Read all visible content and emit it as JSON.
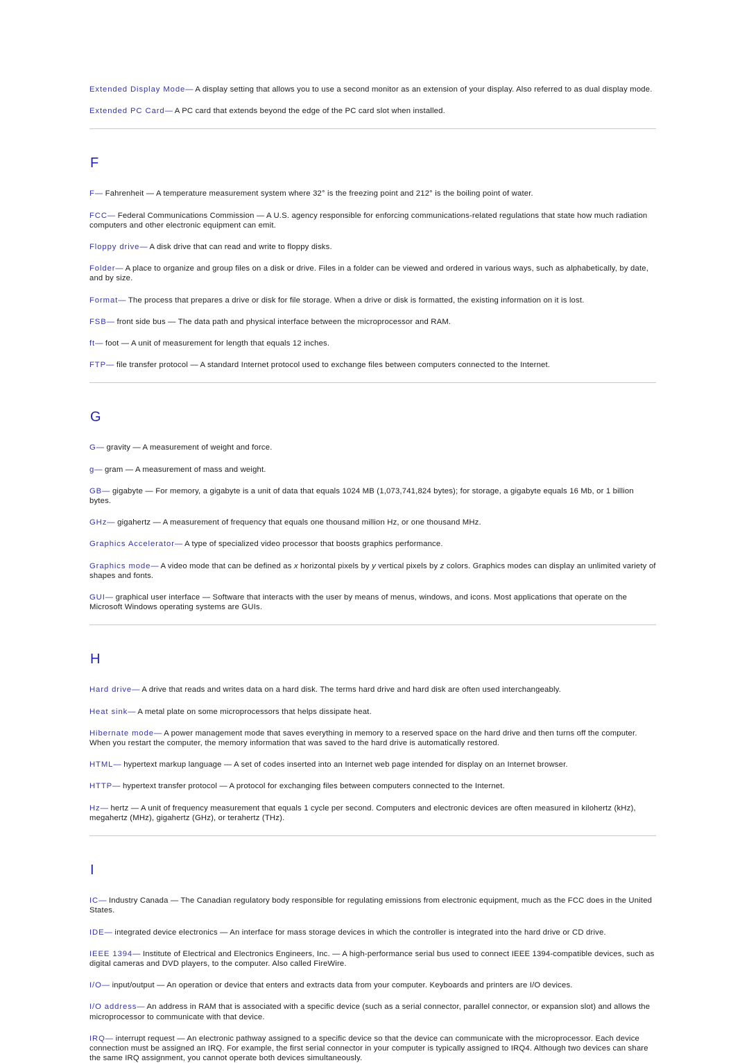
{
  "document": {
    "type": "glossary",
    "colors": {
      "term": "#3333aa",
      "heading": "#2222aa",
      "body": "#1a1a1a",
      "rule": "#c9c9c9",
      "background": "#ffffff"
    }
  },
  "top_entries": [
    {
      "term": "Extended Display Mode",
      "dash": "—",
      "definition": "A display setting that allows you to use a second monitor as an extension of your display. Also referred to as dual display mode."
    },
    {
      "term": "Extended PC Card",
      "dash": "—",
      "definition": "A PC card that extends beyond the edge of the PC card slot when installed."
    }
  ],
  "sections": [
    {
      "letter": "F",
      "entries": [
        {
          "term": "F",
          "dash": "—",
          "definition": "Fahrenheit — A temperature measurement system where 32° is the freezing point and 212° is the boiling point of water."
        },
        {
          "term": "FCC",
          "dash": "—",
          "definition": "Federal Communications Commission — A U.S. agency responsible for enforcing communications-related regulations that state how much radiation computers and other electronic equipment can emit."
        },
        {
          "term": "Floppy drive",
          "dash": "—",
          "definition": "A disk drive that can read and write to floppy disks."
        },
        {
          "term": "Folder",
          "dash": "—",
          "definition": "A place to organize and group files on a disk or drive. Files in a folder can be viewed and ordered in various ways, such as alphabetically, by date, and by size."
        },
        {
          "term": "Format",
          "dash": "—",
          "definition": "The process that prepares a drive or disk for file storage. When a drive or disk is formatted, the existing information on it is lost."
        },
        {
          "term": "FSB",
          "dash": "—",
          "definition": "front side bus — The data path and physical interface between the microprocessor and RAM."
        },
        {
          "term": "ft",
          "dash": "—",
          "definition": "foot — A unit of measurement for length that equals 12 inches."
        },
        {
          "term": "FTP",
          "dash": "—",
          "definition": "file transfer protocol — A standard Internet protocol used to exchange files between computers connected to the Internet."
        }
      ]
    },
    {
      "letter": "G",
      "entries": [
        {
          "term": "G",
          "dash": "—",
          "definition": "gravity — A measurement of weight and force."
        },
        {
          "term": "g",
          "dash": "—",
          "definition": "gram — A measurement of mass and weight."
        },
        {
          "term": "GB",
          "dash": "—",
          "definition": "gigabyte — For memory, a gigabyte is a unit of data that equals 1024 MB (1,073,741,824 bytes); for storage, a gigabyte equals 16 Mb, or 1 billion bytes."
        },
        {
          "term": "GHz",
          "dash": "—",
          "definition": "gigahertz — A measurement of frequency that equals one thousand million Hz, or one thousand MHz."
        },
        {
          "term": "Graphics Accelerator",
          "dash": "—",
          "definition": "A type of specialized video processor that boosts graphics performance."
        },
        {
          "term": "Graphics mode",
          "dash": "—",
          "definition_parts": [
            {
              "text": "A video mode that can be defined as ",
              "italic": false
            },
            {
              "text": "x",
              "italic": true
            },
            {
              "text": " horizontal pixels by ",
              "italic": false
            },
            {
              "text": "y",
              "italic": true
            },
            {
              "text": " vertical pixels by ",
              "italic": false
            },
            {
              "text": "z",
              "italic": true
            },
            {
              "text": " colors. Graphics modes can display an unlimited variety of shapes and fonts.",
              "italic": false
            }
          ]
        },
        {
          "term": "GUI",
          "dash": "—",
          "definition": "graphical user interface — Software that interacts with the user by means of menus, windows, and icons. Most applications that operate on the Microsoft Windows operating systems are GUIs."
        }
      ]
    },
    {
      "letter": "H",
      "entries": [
        {
          "term": "Hard drive",
          "dash": "—",
          "definition": "A drive that reads and writes data on a hard disk. The terms hard drive and hard disk are often used interchangeably."
        },
        {
          "term": "Heat sink",
          "dash": "—",
          "definition": "A metal plate on some microprocessors that helps dissipate heat."
        },
        {
          "term": "Hibernate mode",
          "dash": "—",
          "definition": "A power management mode that saves everything in memory to a reserved space on the hard drive and then turns off the computer. When you restart the computer, the memory information that was saved to the hard drive is automatically restored."
        },
        {
          "term": "HTML",
          "dash": "—",
          "definition": "hypertext markup language — A set of codes inserted into an Internet web page intended for display on an Internet browser."
        },
        {
          "term": "HTTP",
          "dash": "—",
          "definition": "hypertext transfer protocol — A protocol for exchanging files between computers connected to the Internet."
        },
        {
          "term": "Hz",
          "dash": "—",
          "definition": "hertz — A unit of frequency measurement that equals 1 cycle per second. Computers and electronic devices are often measured in kilohertz (kHz), megahertz (MHz), gigahertz (GHz), or terahertz (THz)."
        }
      ]
    },
    {
      "letter": "I",
      "entries": [
        {
          "term": "IC",
          "dash": "—",
          "definition": "Industry Canada — The Canadian regulatory body responsible for regulating emissions from electronic equipment, much as the FCC does in the United States."
        },
        {
          "term": "IDE",
          "dash": "—",
          "definition": "integrated device electronics — An interface for mass storage devices in which the controller is integrated into the hard drive or CD drive."
        },
        {
          "term": "IEEE 1394",
          "dash": "—",
          "definition": "Institute of Electrical and Electronics Engineers, Inc. — A high-performance serial bus used to connect IEEE 1394-compatible devices, such as digital cameras and DVD players, to the computer. Also called FireWire."
        },
        {
          "term": "I/O",
          "dash": "—",
          "definition": "input/output — An operation or device that enters and extracts data from your computer. Keyboards and printers are I/O devices."
        },
        {
          "term": "I/O address",
          "dash": "—",
          "definition": "An address in RAM that is associated with a specific device (such as a serial connector, parallel connector, or expansion slot) and allows the microprocessor to communicate with that device."
        },
        {
          "term": "IRQ",
          "dash": "—",
          "definition": "interrupt request — An electronic pathway assigned to a specific device so that the device can communicate with the microprocessor. Each device connection must be assigned an IRQ. For example, the first serial connector in your computer is typically assigned to IRQ4. Although two devices can share the same IRQ assignment, you cannot operate both devices simultaneously."
        }
      ]
    }
  ]
}
